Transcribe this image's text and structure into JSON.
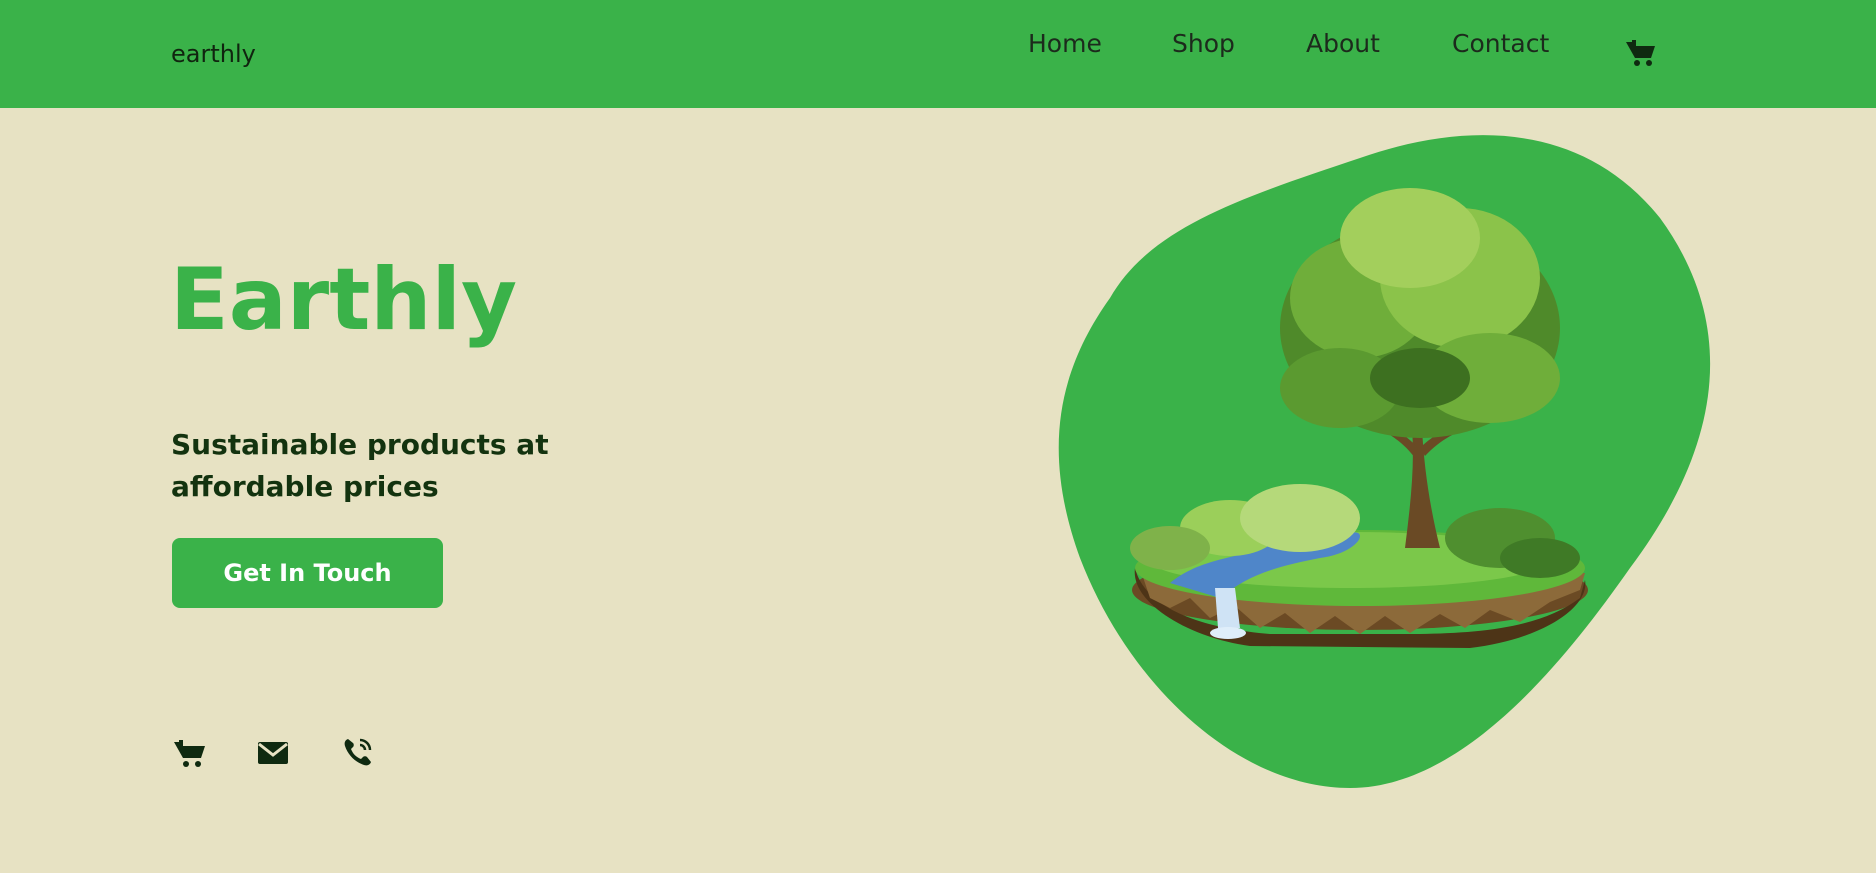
{
  "nav": {
    "brand": "earthly",
    "links": [
      "Home",
      "Shop",
      "About",
      "Contact"
    ],
    "cart_icon": "cart-icon"
  },
  "hero": {
    "title": "Earthly",
    "subtitle": "Sustainable products at affordable prices",
    "cta_label": "Get In Touch",
    "image": "tree-island-illustration"
  },
  "social": {
    "icons": [
      "cart-icon",
      "mail-icon",
      "phone-icon"
    ]
  },
  "colors": {
    "brand_green": "#3ab249",
    "background": "#e7e2c3",
    "text_dark": "#13330f"
  }
}
